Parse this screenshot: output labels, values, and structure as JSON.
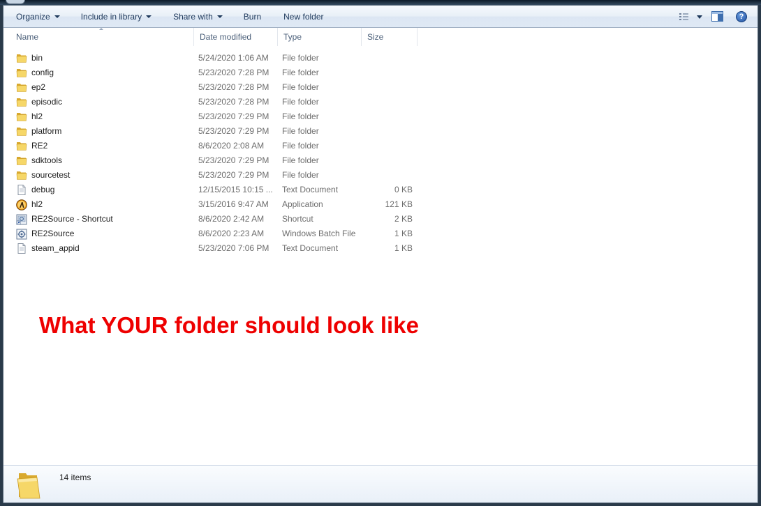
{
  "toolbar": {
    "organize": "Organize",
    "include_in_library": "Include in library",
    "share_with": "Share with",
    "burn": "Burn",
    "new_folder": "New folder",
    "help": "?"
  },
  "columns": {
    "name": "Name",
    "date_modified": "Date modified",
    "type": "Type",
    "size": "Size"
  },
  "files": [
    {
      "name": "bin",
      "date": "5/24/2020 1:06 AM",
      "type": "File folder",
      "size": "",
      "icon": "folder-icon"
    },
    {
      "name": "config",
      "date": "5/23/2020 7:28 PM",
      "type": "File folder",
      "size": "",
      "icon": "folder-icon"
    },
    {
      "name": "ep2",
      "date": "5/23/2020 7:28 PM",
      "type": "File folder",
      "size": "",
      "icon": "folder-icon"
    },
    {
      "name": "episodic",
      "date": "5/23/2020 7:28 PM",
      "type": "File folder",
      "size": "",
      "icon": "folder-icon"
    },
    {
      "name": "hl2",
      "date": "5/23/2020 7:29 PM",
      "type": "File folder",
      "size": "",
      "icon": "folder-icon"
    },
    {
      "name": "platform",
      "date": "5/23/2020 7:29 PM",
      "type": "File folder",
      "size": "",
      "icon": "folder-icon"
    },
    {
      "name": "RE2",
      "date": "8/6/2020 2:08 AM",
      "type": "File folder",
      "size": "",
      "icon": "folder-icon"
    },
    {
      "name": "sdktools",
      "date": "5/23/2020 7:29 PM",
      "type": "File folder",
      "size": "",
      "icon": "folder-icon"
    },
    {
      "name": "sourcetest",
      "date": "5/23/2020 7:29 PM",
      "type": "File folder",
      "size": "",
      "icon": "folder-icon"
    },
    {
      "name": "debug",
      "date": "12/15/2015 10:15 ...",
      "type": "Text Document",
      "size": "0 KB",
      "icon": "text-document-icon"
    },
    {
      "name": "hl2",
      "date": "3/15/2016 9:47 AM",
      "type": "Application",
      "size": "121 KB",
      "icon": "half-life-app-icon"
    },
    {
      "name": "RE2Source - Shortcut",
      "date": "8/6/2020 2:42 AM",
      "type": "Shortcut",
      "size": "2 KB",
      "icon": "shortcut-icon"
    },
    {
      "name": "RE2Source",
      "date": "8/6/2020 2:23 AM",
      "type": "Windows Batch File",
      "size": "1 KB",
      "icon": "batch-file-icon"
    },
    {
      "name": "steam_appid",
      "date": "5/23/2020 7:06 PM",
      "type": "Text Document",
      "size": "1 KB",
      "icon": "text-document-icon"
    }
  ],
  "annotation": "What YOUR folder should look like",
  "status": {
    "item_count": "14 items"
  },
  "colors": {
    "annotation": "#ee0000",
    "toolbar_text": "#1e395b",
    "folder_yellow": "#f3cf5a"
  }
}
